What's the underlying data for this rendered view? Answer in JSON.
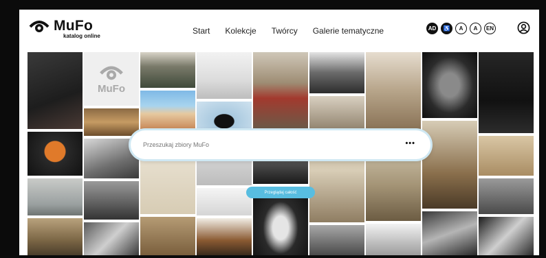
{
  "brand": {
    "title": "MuFo",
    "subtitle": "katalog online",
    "watermark": "MuFo"
  },
  "nav": {
    "items": [
      {
        "label": "Start"
      },
      {
        "label": "Kolekcje"
      },
      {
        "label": "Twórcy"
      },
      {
        "label": "Galerie tematyczne"
      }
    ]
  },
  "accessibility": {
    "icons": [
      {
        "name": "audio-description-icon",
        "text": "AD"
      },
      {
        "name": "accessibility-icon",
        "text": "♿"
      },
      {
        "name": "font-size-icon",
        "text": "A"
      },
      {
        "name": "contrast-icon",
        "text": "A"
      },
      {
        "name": "language-icon",
        "text": "EN"
      }
    ]
  },
  "search": {
    "placeholder": "Przeszukaj zbiory MuFo",
    "more": "•••"
  },
  "browse": {
    "label": "Przeglądaj całość"
  },
  "colors": {
    "accent": "#58bde0",
    "frame": "#0b0b0b"
  }
}
